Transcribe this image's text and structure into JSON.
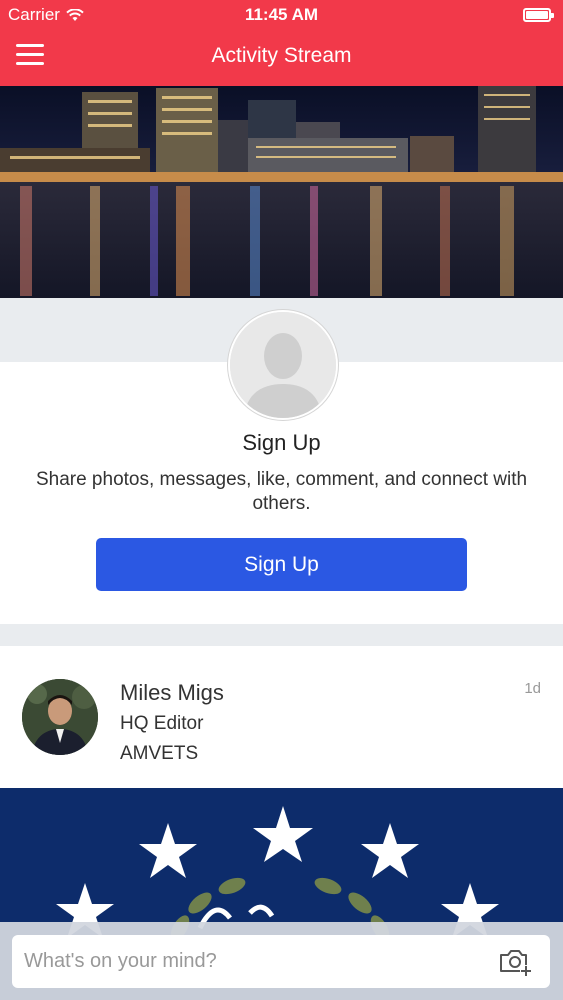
{
  "status_bar": {
    "carrier": "Carrier",
    "time": "11:45 AM"
  },
  "nav": {
    "title": "Activity Stream",
    "menu_icon": "hamburger-menu-icon"
  },
  "signup": {
    "title": "Sign Up",
    "description": "Share photos, messages, like, comment, and connect with others.",
    "button_label": "Sign Up"
  },
  "post": {
    "author": "Miles Migs",
    "role": "HQ Editor",
    "organization": "AMVETS",
    "timestamp": "1d"
  },
  "composer": {
    "placeholder": "What's on your mind?",
    "camera_icon": "camera-add-icon"
  },
  "colors": {
    "brand_red": "#f2394a",
    "primary_blue": "#2b58e3",
    "navy": "#0d2c6b"
  }
}
